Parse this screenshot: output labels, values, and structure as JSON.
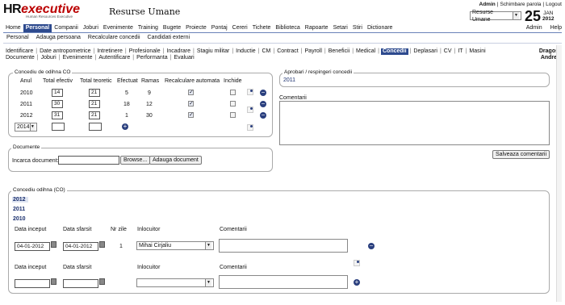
{
  "brand": {
    "hr": "HR",
    "executive": "executive",
    "tagline": "Human Resources Executive"
  },
  "app_title": "Resurse Umane",
  "top_links": {
    "user": "Admin",
    "sep1": "|",
    "change_password": "Schimbare parola",
    "sep2": "|",
    "logout": "Logout"
  },
  "module_select": {
    "value": "Resurse Umane"
  },
  "date": {
    "day": "25",
    "month": "JAN",
    "year": "2012"
  },
  "main_menu": [
    "Home",
    "Personal",
    "Companii",
    "Joburi",
    "Evenimente",
    "Training",
    "Bugete",
    "Proiecte",
    "Pontaj",
    "Cereri",
    "Tichete",
    "Biblioteca",
    "Rapoarte",
    "Setari",
    "Stiri",
    "Dictionare"
  ],
  "main_menu_active": "Personal",
  "main_menu_right": [
    "Admin",
    "Help"
  ],
  "sub_menu": [
    "Personal",
    "Adauga persoana",
    "Recalculare concedii",
    "Candidati externi"
  ],
  "tabs_row1": [
    "Identificare",
    "Date antropometrice",
    "Intretinere",
    "Profesionale",
    "Incadrare",
    "Stagiu militar",
    "Inductie",
    "CM",
    "Contract",
    "Payroll",
    "Beneficii",
    "Medical",
    "Concedii",
    "Deplasari",
    "CV",
    "IT",
    "Masini"
  ],
  "tabs_row2": [
    "Documente",
    "Joburi",
    "Evenimente",
    "Autentificare",
    "Performanta",
    "Evaluari"
  ],
  "active_tab": "Concedii",
  "employee": {
    "first": "Dragos",
    "last": "Andrei"
  },
  "co_panel": {
    "legend": "Concediu de odihna CO",
    "headers": [
      "Anul",
      "Total efectiv",
      "Total teoretic",
      "Efectuat",
      "Ramas",
      "Recalculare automata",
      "Inchide"
    ],
    "rows": [
      {
        "year": "2010",
        "efectiv": "14",
        "teoretic": "21",
        "efectuat": "5",
        "ramas": "9"
      },
      {
        "year": "2011",
        "efectiv": "30",
        "teoretic": "21",
        "efectuat": "18",
        "ramas": "12"
      },
      {
        "year": "2012",
        "efectiv": "31",
        "teoretic": "21",
        "efectuat": "1",
        "ramas": "30"
      }
    ],
    "new_year": "2014"
  },
  "documents": {
    "legend": "Documente",
    "upload_label": "Incarca document:",
    "browse": "Browse...",
    "add": "Adauga document"
  },
  "approvals": {
    "legend": "Aprobari / respingeri concedii",
    "year": "2011"
  },
  "comments": {
    "label": "Comentarii",
    "save": "Salveaza comentarii"
  },
  "co_detail": {
    "legend": "Concediu odihna (CO)",
    "years": [
      "2012",
      "2011",
      "2010"
    ],
    "headers": {
      "start": "Data inceput",
      "end": "Data sfarsit",
      "days": "Nr zile",
      "replacement": "Inlocuitor",
      "comments": "Comentarii"
    },
    "entry": {
      "start": "04-01-2012",
      "end": "04-01-2012",
      "days": "1",
      "replacement": "Mihai Cirjaliu"
    },
    "headers2": {
      "start": "Data inceput",
      "end": "Data sfarsit",
      "replacement": "Inlocuitor",
      "comments": "Comentarii"
    }
  },
  "colors": {
    "accent": "#2d4a8e",
    "logo_red": "#b00000"
  }
}
